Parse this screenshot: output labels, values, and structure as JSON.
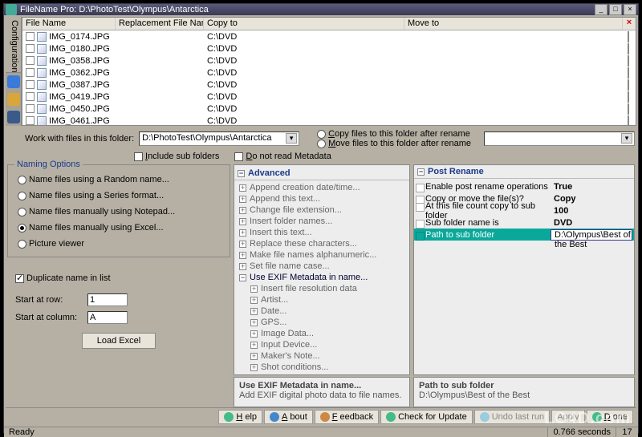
{
  "window": {
    "title": "FileName Pro: D:\\PhotoTest\\Olympus\\Antarctica"
  },
  "grid": {
    "columns": [
      "File Name",
      "Replacement File Name",
      "Copy to",
      "Move to"
    ],
    "rows": [
      {
        "file": "IMG_0174.JPG",
        "repl": "",
        "copy": "C:\\DVD",
        "move": ""
      },
      {
        "file": "IMG_0180.JPG",
        "repl": "",
        "copy": "C:\\DVD",
        "move": ""
      },
      {
        "file": "IMG_0358.JPG",
        "repl": "",
        "copy": "C:\\DVD",
        "move": ""
      },
      {
        "file": "IMG_0362.JPG",
        "repl": "",
        "copy": "C:\\DVD",
        "move": ""
      },
      {
        "file": "IMG_0387.JPG",
        "repl": "",
        "copy": "C:\\DVD",
        "move": ""
      },
      {
        "file": "IMG_0419.JPG",
        "repl": "",
        "copy": "C:\\DVD",
        "move": ""
      },
      {
        "file": "IMG_0450.JPG",
        "repl": "",
        "copy": "C:\\DVD",
        "move": ""
      },
      {
        "file": "IMG_0461.JPG",
        "repl": "",
        "copy": "C:\\DVD",
        "move": ""
      }
    ]
  },
  "sidetab": {
    "label": "Configuration"
  },
  "folder": {
    "label": "Work with files in this folder:",
    "value": "D:\\PhotoTest\\Olympus\\Antarctica",
    "include_sub": "Include sub folders",
    "no_meta": "Do not read Metadata",
    "copy_after": "Copy files to this folder after rename",
    "move_after": "Move files to this folder after rename",
    "dest_value": ""
  },
  "naming": {
    "legend": "Naming Options",
    "opts": [
      "Name files using a Random name...",
      "Name files using a Series format...",
      "Name files manually using Notepad...",
      "Name files manually using Excel...",
      "Picture viewer"
    ],
    "selected": 3,
    "dup": "Duplicate name in list",
    "start_row_lbl": "Start at row:",
    "start_row_val": "1",
    "start_col_lbl": "Start at column:",
    "start_col_val": "A",
    "load_btn": "Load Excel"
  },
  "tree": {
    "head": "Advanced",
    "nodes": [
      {
        "t": "Append creation date/time...",
        "d": 0,
        "e": "+"
      },
      {
        "t": "Append this text...",
        "d": 0,
        "e": "+"
      },
      {
        "t": "Change file extension...",
        "d": 0,
        "e": "+"
      },
      {
        "t": "Insert folder names...",
        "d": 0,
        "e": "+"
      },
      {
        "t": "Insert this text...",
        "d": 0,
        "e": "+"
      },
      {
        "t": "Replace these characters...",
        "d": 0,
        "e": "+"
      },
      {
        "t": "Make file names alphanumeric...",
        "d": 0,
        "e": "+"
      },
      {
        "t": "Set file name case...",
        "d": 0,
        "e": "+"
      },
      {
        "t": "Use EXIF Metadata in name...",
        "d": 0,
        "e": "−",
        "sel": true
      },
      {
        "t": "Insert file resolution data",
        "d": 1,
        "e": "+"
      },
      {
        "t": "Artist...",
        "d": 1,
        "e": "+"
      },
      {
        "t": "Date...",
        "d": 1,
        "e": "+"
      },
      {
        "t": "GPS...",
        "d": 1,
        "e": "+"
      },
      {
        "t": "Image Data...",
        "d": 1,
        "e": "+"
      },
      {
        "t": "Input Device...",
        "d": 1,
        "e": "+"
      },
      {
        "t": "Maker's Note...",
        "d": 1,
        "e": "+"
      },
      {
        "t": "Shot conditions...",
        "d": 1,
        "e": "+"
      }
    ],
    "desc_t": "Use EXIF Metadata in name...",
    "desc_d": "Add EXIF digital photo data to file names."
  },
  "props": {
    "head": "Post Rename",
    "rows": [
      {
        "k": "Enable post rename operations",
        "v": "True"
      },
      {
        "k": "Copy or move the file(s)?",
        "v": "Copy"
      },
      {
        "k": "At this file count copy to sub folder",
        "v": "100"
      },
      {
        "k": "Sub folder name is",
        "v": "DVD"
      },
      {
        "k": "Path to sub folder",
        "v": "D:\\Olympus\\Best of the Best",
        "hi": true
      }
    ],
    "desc_t": "Path to sub folder",
    "desc_d": "D:\\Olympus\\Best of the Best"
  },
  "bottom": {
    "help": "Help",
    "about": "About",
    "feedback": "Feedback",
    "update": "Check for Update",
    "undo": "Undo last run",
    "apply": "Apply",
    "done": "Done"
  },
  "status": {
    "ready": "Ready",
    "time": "0.766 seconds",
    "count": "17"
  },
  "watermark": "LO4D.com"
}
